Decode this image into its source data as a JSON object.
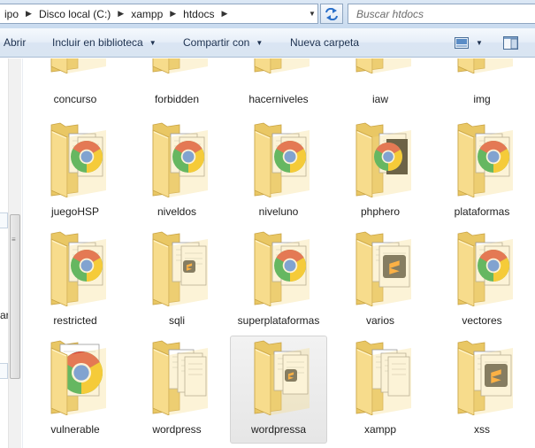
{
  "address": {
    "breadcrumbs": [
      {
        "label": "ipo"
      },
      {
        "label": "Disco local (C:)"
      },
      {
        "label": "xampp"
      },
      {
        "label": "htdocs"
      }
    ],
    "search_placeholder": "Buscar htdocs"
  },
  "toolbar": {
    "abrir": "Abrir",
    "incluir": "Incluir en biblioteca",
    "compartir": "Compartir con",
    "nueva_carpeta": "Nueva carpeta"
  },
  "nav": {
    "peek_text": "ar"
  },
  "colors": {
    "folder_back": "#e9c764",
    "folder_front": "#f7dc8c",
    "sublime_bg": "#4a4a4a",
    "sublime_s": "#ff9a1f",
    "selection": "#e8e8e8"
  },
  "folders": [
    {
      "name": "concurso",
      "content": "chrome"
    },
    {
      "name": "forbidden",
      "content": "docs"
    },
    {
      "name": "hacerniveles",
      "content": "chrome"
    },
    {
      "name": "iaw",
      "content": "docs-blue"
    },
    {
      "name": "img",
      "content": "docs-gray"
    },
    {
      "name": "juegoHSP",
      "content": "chrome"
    },
    {
      "name": "niveldos",
      "content": "chrome"
    },
    {
      "name": "niveluno",
      "content": "chrome"
    },
    {
      "name": "phphero",
      "content": "chrome-dark"
    },
    {
      "name": "plataformas",
      "content": "chrome"
    },
    {
      "name": "restricted",
      "content": "chrome"
    },
    {
      "name": "sqli",
      "content": "sublime-small"
    },
    {
      "name": "superplataformas",
      "content": "chrome"
    },
    {
      "name": "varios",
      "content": "sublime"
    },
    {
      "name": "vectores",
      "content": "chrome"
    },
    {
      "name": "vulnerable",
      "content": "chrome-big"
    },
    {
      "name": "wordpress",
      "content": "docs"
    },
    {
      "name": "wordpressa",
      "content": "sublime-small",
      "selected": true
    },
    {
      "name": "xampp",
      "content": "docs"
    },
    {
      "name": "xss",
      "content": "sublime"
    }
  ]
}
